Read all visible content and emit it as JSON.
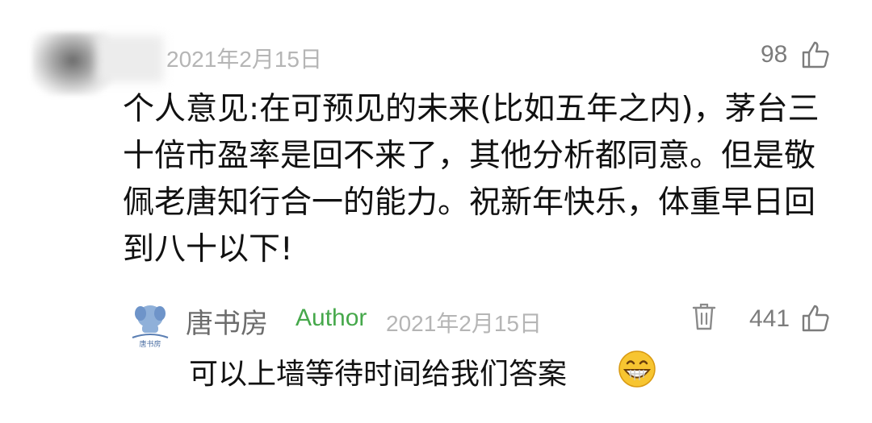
{
  "comment": {
    "date": "2021年2月15日",
    "likes": "98",
    "text": "个人意见:在可预见的未来(比如五年之内)，茅台三十倍市盈率是回不来了，其他分析都同意。但是敬佩老唐知行合一的能力。祝新年快乐，体重早日回到八十以下!"
  },
  "reply": {
    "author_name": "唐书房",
    "author_badge": "Author",
    "date": "2021年2月15日",
    "likes": "441",
    "text": "可以上墙等待时间给我们答案",
    "avatar_caption": "唐书房",
    "emoji_icon": "grinning-face-icon"
  },
  "colors": {
    "author_badge": "#46a84b",
    "muted_text": "#b5b5b5",
    "count_text": "#7c7c7c",
    "body_text": "#111111"
  }
}
